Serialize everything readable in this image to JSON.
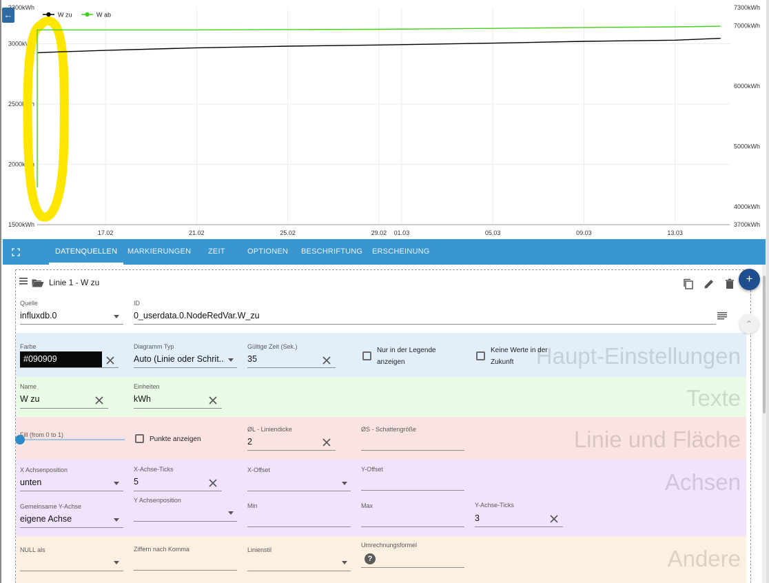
{
  "chart": {
    "back_label": "←",
    "legend": [
      {
        "name": "W zu",
        "color": "#000000"
      },
      {
        "name": "W ab",
        "color": "#44d11a"
      }
    ]
  },
  "chart_data": {
    "type": "line",
    "series": [
      {
        "name": "W zu",
        "color": "#000000",
        "axis": "left",
        "x": [
          "14.02",
          "15.02",
          "17.02",
          "21.02",
          "25.02",
          "29.02",
          "05.03",
          "09.03",
          "13.03",
          "15.03"
        ],
        "y": [
          2925,
          2933,
          2945,
          2966,
          2980,
          2990,
          3005,
          3020,
          3030,
          3045
        ]
      },
      {
        "name": "W ab",
        "color": "#44d11a",
        "axis": "right",
        "x": [
          "14.02",
          "14.02",
          "17.02",
          "21.02",
          "25.02",
          "29.02",
          "05.03",
          "09.03",
          "13.03",
          "15.03"
        ],
        "y": [
          4320,
          6930,
          6930,
          6930,
          6935,
          6940,
          6955,
          6970,
          6980,
          6990
        ]
      }
    ],
    "x_ticks": [
      "17.02",
      "21.02",
      "25.02",
      "29.02",
      "01.03",
      "05.03",
      "09.03",
      "13.03"
    ],
    "y_left_ticks": [
      "1500kWh",
      "2000kWh",
      "2500kWh",
      "3000kWh",
      "3300kWh"
    ],
    "y_right_ticks": [
      "3700kWh",
      "4000kWh",
      "5000kWh",
      "6000kWh",
      "7000kWh",
      "7300kWh"
    ],
    "y_left_range": [
      1500,
      3300
    ],
    "y_right_range": [
      3700,
      7300
    ],
    "grid": true,
    "legend_position": "top-left",
    "highlight_color": "#ffe600"
  },
  "tabs": {
    "items": [
      "DATENQUELLEN",
      "MARKIERUNGEN",
      "ZEIT",
      "OPTIONEN",
      "BESCHRIFTUNG",
      "ERSCHEINUNG"
    ],
    "active": "DATENQUELLEN"
  },
  "panel": {
    "title": "Linie 1 - W zu",
    "fab_add": "+",
    "fab_small": "⌃",
    "source_label": "Quelle",
    "source_value": "influxdb.0",
    "id_label": "ID",
    "id_value": "0_userdata.0.NodeRedVar.W_zu"
  },
  "main_settings": {
    "section_title": "Haupt-Einstellungen",
    "bg": "#e3eefb",
    "color_label": "Farbe",
    "color_value": "#090909",
    "chart_type_label": "Diagramm Typ",
    "chart_type_value": "Auto (Linie oder Schrit...",
    "valid_time_label": "Gültige Zeit (Sek.)",
    "valid_time_value": "35",
    "legend_only_label_1": "Nur in der Legende",
    "legend_only_label_2": "anzeigen",
    "no_future_label_1": "Keine Werte in der",
    "no_future_label_2": "Zukunft"
  },
  "texts": {
    "section_title": "Texte",
    "bg": "#e9fbe5",
    "name_label": "Name",
    "name_value": "W zu",
    "unit_label": "Einheiten",
    "unit_value": "kWh"
  },
  "line_area": {
    "section_title": "Linie und Fläche",
    "bg": "#fbe3e3",
    "fill_label": "Fill (from 0 to 1)",
    "fill_value": 0,
    "points_label": "Punkte anzeigen",
    "line_width_label": "ØL - Liniendicke",
    "line_width_value": "2",
    "shadow_label": "ØS - Schattengröße"
  },
  "axes": {
    "section_title": "Achsen",
    "bg": "#f1e3fb",
    "x_pos_label": "X Achsenposition",
    "x_pos_value": "unten",
    "x_ticks_label": "X-Achse-Ticks",
    "x_ticks_value": "5",
    "x_offset_label": "X-Offset",
    "y_offset_label": "Y-Offset",
    "common_y_label": "Gemeinsame Y-Achse",
    "common_y_value": "eigene Achse",
    "y_pos_label": "Y Achsenposition",
    "min_label": "Min",
    "max_label": "Max",
    "y_ticks_label": "Y-Achse-Ticks",
    "y_ticks_value": "3"
  },
  "other": {
    "section_title": "Andere",
    "bg": "#fdf0e1",
    "null_label": "NULL als",
    "digits_label": "Ziffern nach Komma",
    "line_style_label": "Linienstil",
    "formula_label": "Umrechnungsformel",
    "help": "?"
  }
}
